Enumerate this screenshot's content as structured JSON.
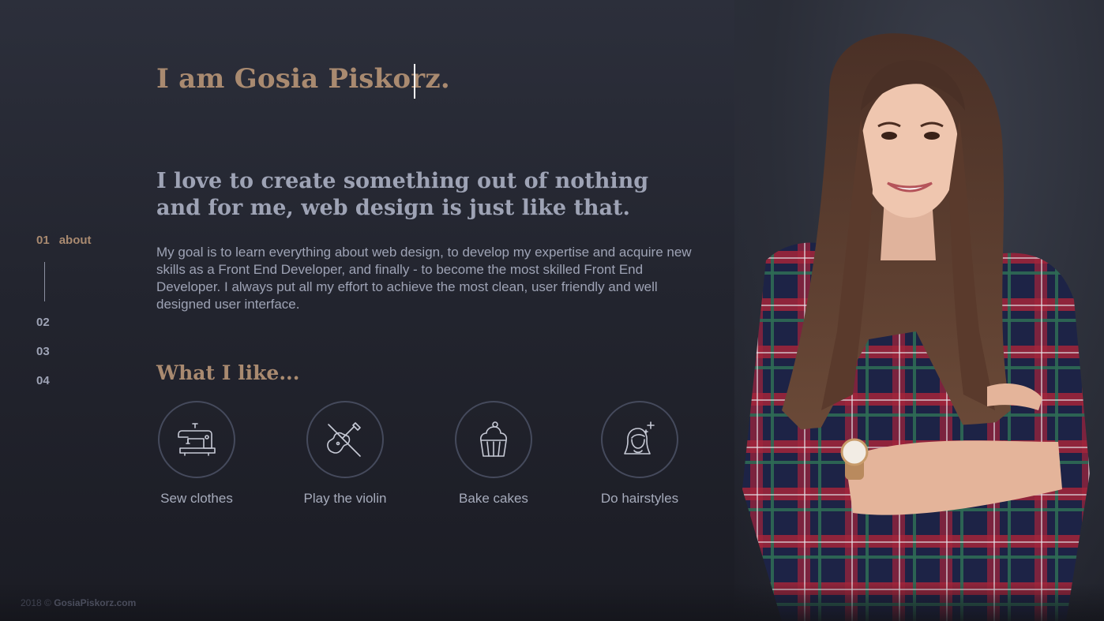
{
  "hero": {
    "headline": "I am Gosia Piskorz.",
    "tagline": "I love to create something out of nothing and for me, web design is just like that.",
    "intro": "My goal is to learn everything about web design, to develop my expertise and acquire new skills as a Front End Developer, and finally - to become the most skilled Front End Developer. I always put all my effort to achieve the most clean, user friendly and well designed user interface."
  },
  "nav": {
    "items": [
      {
        "number": "01",
        "label": "about"
      },
      {
        "number": "02"
      },
      {
        "number": "03"
      },
      {
        "number": "04"
      }
    ]
  },
  "likes": {
    "title": "What I like...",
    "items": [
      {
        "label": "Sew clothes",
        "icon": "sewing-machine-icon"
      },
      {
        "label": "Play the violin",
        "icon": "violin-icon"
      },
      {
        "label": "Bake cakes",
        "icon": "cupcake-icon"
      },
      {
        "label": "Do hairstyles",
        "icon": "hairstyle-icon"
      }
    ]
  },
  "footer": {
    "year": "2018 ©",
    "site": "GosiaPiskorz.com"
  },
  "colors": {
    "accent": "#a98a70",
    "text": "#9ea3b5",
    "background": "#23252f"
  }
}
